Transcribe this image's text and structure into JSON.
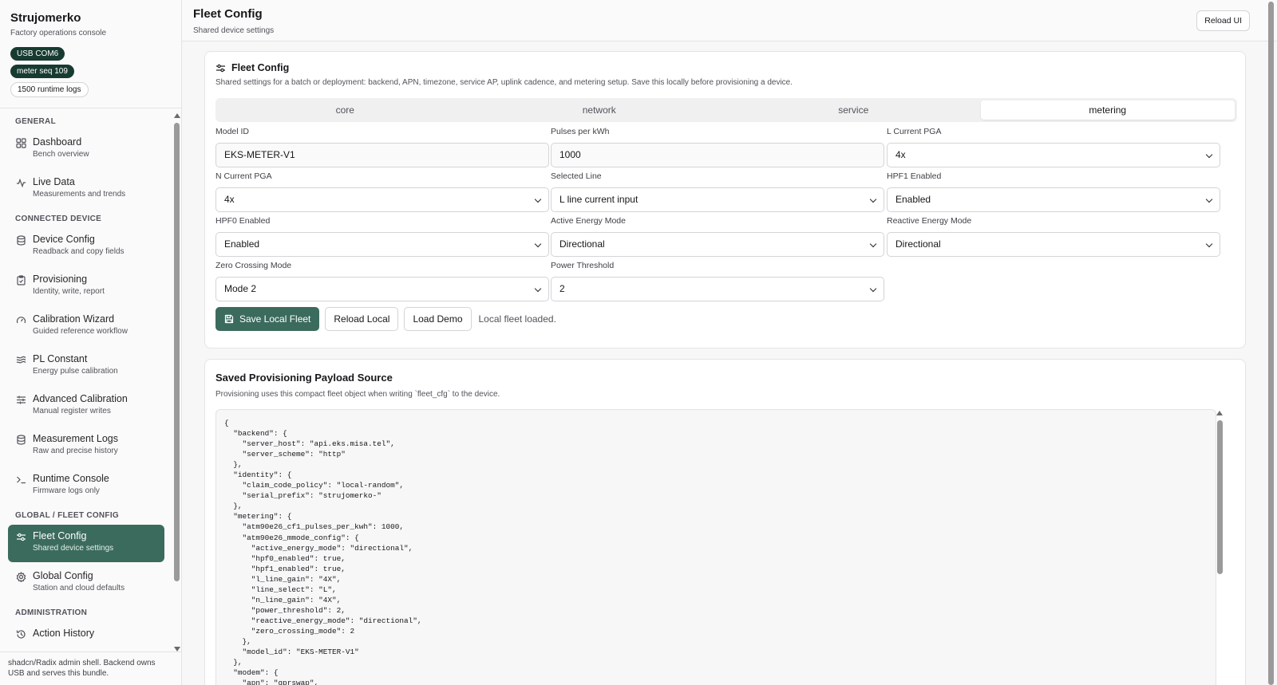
{
  "sidebar": {
    "brand_title": "Strujomerko",
    "brand_subtitle": "Factory operations console",
    "badges": [
      "USB COM6",
      "meter seq 109",
      "1500 runtime logs"
    ],
    "sections": {
      "general": "GENERAL",
      "connected": "CONNECTED DEVICE",
      "global": "GLOBAL / FLEET CONFIG",
      "admin": "ADMINISTRATION"
    },
    "items": [
      {
        "label": "Dashboard",
        "desc": "Bench overview",
        "icon": "grid-icon"
      },
      {
        "label": "Live Data",
        "desc": "Measurements and trends",
        "icon": "activity-icon"
      },
      {
        "label": "Device Config",
        "desc": "Readback and copy fields",
        "icon": "database-icon"
      },
      {
        "label": "Provisioning",
        "desc": "Identity, write, report",
        "icon": "clipboard-icon"
      },
      {
        "label": "Calibration Wizard",
        "desc": "Guided reference workflow",
        "icon": "gauge-icon"
      },
      {
        "label": "PL Constant",
        "desc": "Energy pulse calibration",
        "icon": "waves-icon"
      },
      {
        "label": "Advanced Calibration",
        "desc": "Manual register writes",
        "icon": "sliders-icon"
      },
      {
        "label": "Measurement Logs",
        "desc": "Raw and precise history",
        "icon": "database-icon"
      },
      {
        "label": "Runtime Console",
        "desc": "Firmware logs only",
        "icon": "terminal-icon"
      },
      {
        "label": "Fleet Config",
        "desc": "Shared device settings",
        "icon": "settings-sliders-icon"
      },
      {
        "label": "Global Config",
        "desc": "Station and cloud defaults",
        "icon": "gear-icon"
      },
      {
        "label": "Action History",
        "desc": "",
        "icon": "history-icon"
      }
    ],
    "footer": "shadcn/Radix admin shell. Backend owns USB and serves this bundle."
  },
  "header": {
    "title": "Fleet Config",
    "subtitle": "Shared device settings",
    "reload_label": "Reload UI"
  },
  "fleet_card": {
    "title": "Fleet Config",
    "description": "Shared settings for a batch or deployment: backend, APN, timezone, service AP, uplink cadence, and metering setup. Save this locally before provisioning a device.",
    "tabs": [
      "core",
      "network",
      "service",
      "metering"
    ],
    "active_tab": "metering",
    "fields": {
      "model_id": {
        "label": "Model ID",
        "value": "EKS-METER-V1"
      },
      "pulses": {
        "label": "Pulses per kWh",
        "value": "1000"
      },
      "l_pga": {
        "label": "L Current PGA",
        "value": "4x"
      },
      "n_pga": {
        "label": "N Current PGA",
        "value": "4x"
      },
      "selected_line": {
        "label": "Selected Line",
        "value": "L line current input"
      },
      "hpf1": {
        "label": "HPF1 Enabled",
        "value": "Enabled"
      },
      "hpf0": {
        "label": "HPF0 Enabled",
        "value": "Enabled"
      },
      "active_energy": {
        "label": "Active Energy Mode",
        "value": "Directional"
      },
      "reactive_energy": {
        "label": "Reactive Energy Mode",
        "value": "Directional"
      },
      "zero_crossing": {
        "label": "Zero Crossing Mode",
        "value": "Mode 2"
      },
      "power_threshold": {
        "label": "Power Threshold",
        "value": "2"
      }
    },
    "buttons": {
      "save": "Save Local Fleet",
      "reload": "Reload Local",
      "demo": "Load Demo"
    },
    "status": "Local fleet loaded."
  },
  "payload_card": {
    "title": "Saved Provisioning Payload Source",
    "description": "Provisioning uses this compact fleet object when writing `fleet_cfg` to the device.",
    "code": "{\n  \"backend\": {\n    \"server_host\": \"api.eks.misa.tel\",\n    \"server_scheme\": \"http\"\n  },\n  \"identity\": {\n    \"claim_code_policy\": \"local-random\",\n    \"serial_prefix\": \"strujomerko-\"\n  },\n  \"metering\": {\n    \"atm90e26_cf1_pulses_per_kwh\": 1000,\n    \"atm90e26_mmode_config\": {\n      \"active_energy_mode\": \"directional\",\n      \"hpf0_enabled\": true,\n      \"hpf1_enabled\": true,\n      \"l_line_gain\": \"4X\",\n      \"line_select\": \"L\",\n      \"n_line_gain\": \"4X\",\n      \"power_threshold\": 2,\n      \"reactive_energy_mode\": \"directional\",\n      \"zero_crossing_mode\": 2\n    },\n    \"model_id\": \"EKS-METER-V1\"\n  },\n  \"modem\": {\n    \"apn\": \"gprswap\","
  },
  "colors": {
    "accent": "#3b6b5d",
    "badge_dark": "#173b30"
  }
}
